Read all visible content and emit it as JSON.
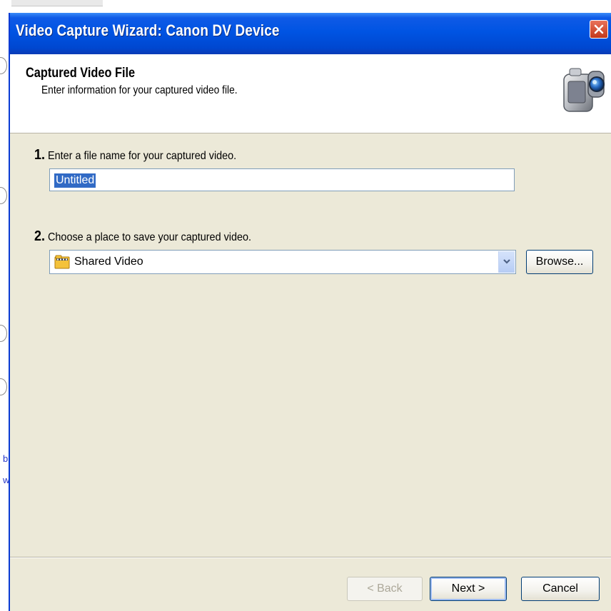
{
  "window": {
    "title": "Video Capture Wizard: Canon DV Device"
  },
  "header": {
    "title": "Captured Video File",
    "subtitle": "Enter information for your captured video file."
  },
  "step1": {
    "number": "1.",
    "label": "Enter a file name for your captured video.",
    "filename_value": "Untitled"
  },
  "step2": {
    "number": "2.",
    "label": "Choose a place to save your captured video.",
    "location_value": "Shared Video",
    "browse_label": "Browse..."
  },
  "footer": {
    "back_label": "< Back",
    "next_label": "Next >",
    "cancel_label": "Cancel"
  },
  "background": {
    "link_chars": [
      "b",
      "w"
    ]
  },
  "colors": {
    "titlebar": "#0054e3",
    "dialog_bg": "#ece9d8",
    "selection": "#316ac5"
  },
  "icons": {
    "close": "close-icon",
    "camera": "camcorder-icon",
    "folder": "video-folder-icon",
    "dropdown": "chevron-down-icon"
  }
}
